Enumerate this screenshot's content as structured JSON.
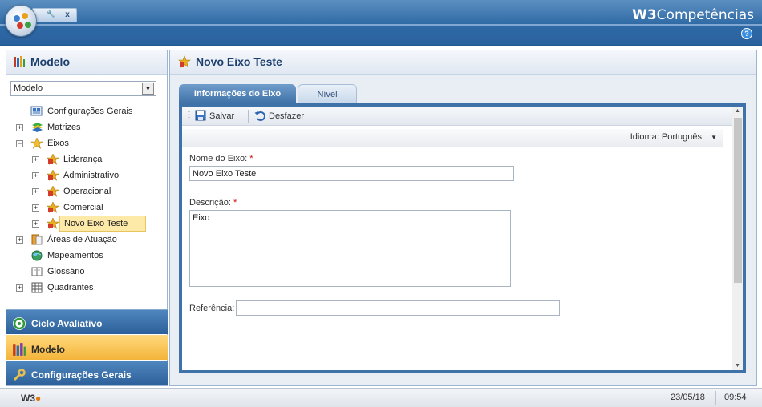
{
  "brand": {
    "bold": "W3",
    "rest": "Competências"
  },
  "help": "?",
  "quickbar": {
    "wrench": "🔧",
    "close": "x"
  },
  "left": {
    "title": "Modelo",
    "select_value": "Modelo",
    "tree": [
      {
        "label": "Configurações Gerais",
        "icon": "config-icon",
        "expander": ""
      },
      {
        "label": "Matrizes",
        "icon": "layers-icon",
        "expander": "+"
      },
      {
        "label": "Eixos",
        "icon": "star-icon",
        "expander": "−"
      },
      {
        "label": "Liderança",
        "icon": "axis-icon",
        "expander": "+"
      },
      {
        "label": "Administrativo",
        "icon": "axis-icon",
        "expander": "+"
      },
      {
        "label": "Operacional",
        "icon": "axis-icon",
        "expander": "+"
      },
      {
        "label": "Comercial",
        "icon": "axis-icon",
        "expander": "+"
      },
      {
        "label": "Novo Eixo Teste",
        "icon": "axis-icon",
        "expander": "+",
        "selected": true
      },
      {
        "label": "Áreas de Atuação",
        "icon": "folder-icon",
        "expander": "+"
      },
      {
        "label": "Mapeamentos",
        "icon": "globe-icon",
        "expander": ""
      },
      {
        "label": "Glossário",
        "icon": "book-icon",
        "expander": ""
      },
      {
        "label": "Quadrantes",
        "icon": "grid-icon",
        "expander": "+"
      }
    ]
  },
  "accordion": [
    {
      "label": "Ciclo Avaliativo",
      "icon": "cycle-icon",
      "active": false
    },
    {
      "label": "Modelo",
      "icon": "model-icon",
      "active": true
    },
    {
      "label": "Configurações Gerais",
      "icon": "wrench-icon",
      "active": false
    }
  ],
  "right": {
    "title": "Novo Eixo Teste",
    "tabs": [
      {
        "label": "Informações do Eixo",
        "active": true
      },
      {
        "label": "Nível",
        "active": false
      }
    ],
    "toolbar": {
      "save": "Salvar",
      "undo": "Desfazer"
    },
    "language": {
      "label": "Idioma:",
      "value": "Português"
    },
    "form": {
      "name_label": "Nome do Eixo:",
      "name_value": "Novo Eixo Teste",
      "desc_label": "Descrição:",
      "desc_value": "Eixo",
      "ref_label": "Referência:",
      "ref_value": "",
      "required_mark": "*"
    }
  },
  "status": {
    "logo": "W3",
    "date": "23/05/18",
    "time": "09:54"
  },
  "colors": {
    "accent": "#3f72a8",
    "selection": "#fde9a8",
    "active_accordion": "#f4b43a"
  }
}
